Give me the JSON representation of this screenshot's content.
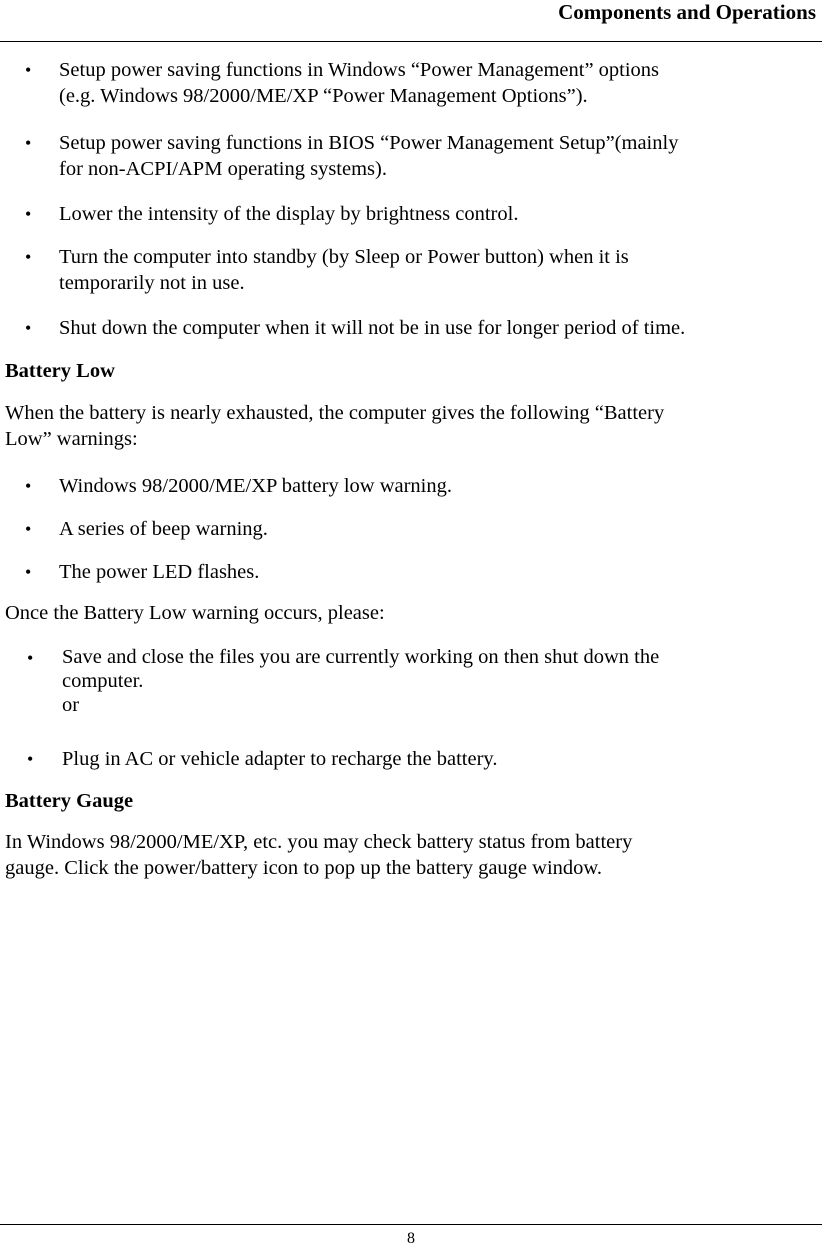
{
  "header": {
    "title": "Components and Operations"
  },
  "power_saving_tips": [
    {
      "bullet": "•",
      "text": "Setup power saving functions in Windows “Power Management” options\n(e.g. Windows 98/2000/ME/XP “Power Management Options”)."
    },
    {
      "bullet": "•",
      "text": "Setup power saving functions in BIOS “Power Management Setup”(mainly\nfor non-ACPI/APM operating systems)."
    },
    {
      "bullet": "•",
      "text": "Lower the intensity of the display by brightness control."
    },
    {
      "bullet": "•",
      "text": "Turn the computer into standby (by Sleep or Power button) when it is\ntemporarily not in use."
    },
    {
      "bullet": "•",
      "text": "Shut down the computer when it will not be in use for longer period of time."
    }
  ],
  "battery_low": {
    "heading": "Battery Low",
    "intro": "When the battery is nearly exhausted, the computer gives the following “Battery\nLow” warnings:",
    "warnings": [
      {
        "bullet": "•",
        "text": "Windows 98/2000/ME/XP battery low warning."
      },
      {
        "bullet": "•",
        "text": "A series of beep warning."
      },
      {
        "bullet": "•",
        "text": "The power LED flashes."
      }
    ],
    "action_intro": "Once the Battery Low warning occurs, please:",
    "actions": [
      {
        "bullet": "•",
        "text": "Save and close the files you are currently working on then shut down the\ncomputer.\nor"
      },
      {
        "bullet": "•",
        "text": "Plug in AC or vehicle adapter to recharge the battery."
      }
    ]
  },
  "battery_gauge": {
    "heading": "Battery Gauge",
    "body": "In Windows 98/2000/ME/XP, etc. you may check battery status from battery\ngauge. Click the power/battery icon to pop up the battery gauge window."
  },
  "footer": {
    "page_number": "8"
  }
}
